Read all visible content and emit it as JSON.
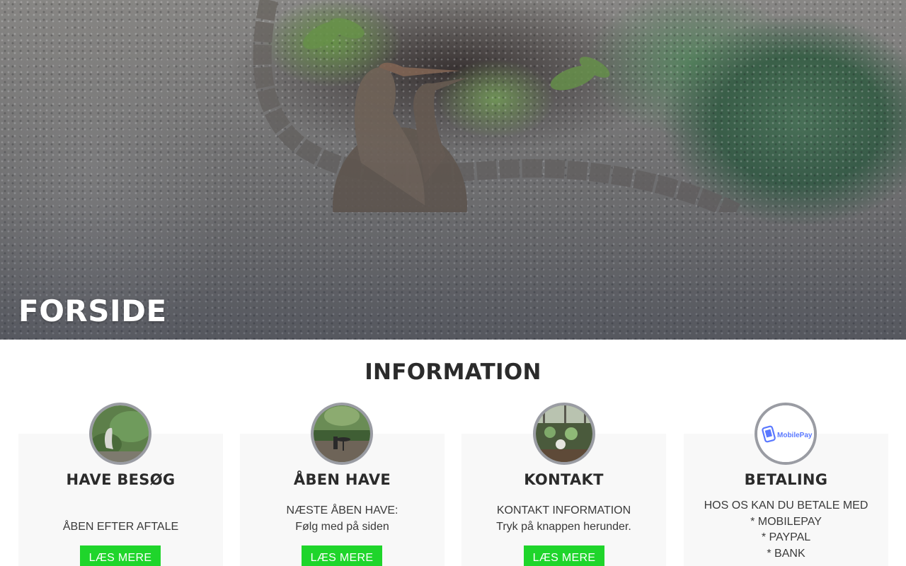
{
  "hero": {
    "title": "FORSIDE"
  },
  "section": {
    "title": "INFORMATION"
  },
  "cards": [
    {
      "title": "HAVE BESØG",
      "lines": [
        "ÅBEN EFTER AFTALE"
      ],
      "button_label": "LÆS MERE",
      "image": "garden-heron-photo"
    },
    {
      "title": "ÅBEN HAVE",
      "lines": [
        "NÆSTE ÅBEN HAVE:",
        "Følg med på siden"
      ],
      "button_label": "LÆS MERE",
      "image": "garden-table-photo"
    },
    {
      "title": "KONTAKT",
      "lines": [
        "KONTAKT INFORMATION",
        "Tryk på knappen herunder."
      ],
      "button_label": "LÆS MERE",
      "image": "garden-greenhouse-photo"
    },
    {
      "title": "BETALING",
      "lines": [
        "HOS OS KAN DU BETALE MED",
        "* MOBILEPAY",
        "* PAYPAL",
        "* BANK"
      ],
      "image": "mobilepay-logo",
      "logo_text": "MobilePay"
    }
  ],
  "colors": {
    "button": "#1fd52b",
    "card_bg": "#f8f8f8",
    "avatar_border": "#9a9ca3",
    "mobilepay_blue": "#5a78ff"
  }
}
